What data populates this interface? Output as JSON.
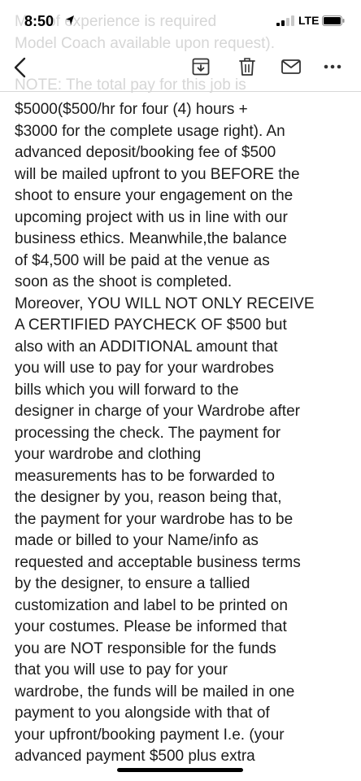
{
  "status_bar": {
    "time": "8:50",
    "network": "LTE"
  },
  "ghost_lines": [
    "M… of experience is required",
    "Model Coach available upon request).",
    "NOTE: The total pay for this job is"
  ],
  "toolbar": {
    "back": "<"
  },
  "message": {
    "lines": [
      "$5000($500/hr for four (4) hours +",
      "$3000 for the complete usage right). An",
      "advanced deposit/booking fee of $500",
      "will be mailed upfront to you BEFORE the",
      "shoot to ensure your engagement on the",
      "upcoming project with us in line with our",
      "business ethics. Meanwhile,the balance",
      "of $4,500 will be paid at the venue as",
      "soon as the shoot is completed.",
      "Moreover, YOU WILL NOT ONLY RECEIVE",
      "A CERTIFIED PAYCHECK OF $500 but",
      "also with an ADDITIONAL amount that",
      "you will use to pay for your wardrobes",
      "bills which you will forward to the",
      "designer in charge of your Wardrobe after",
      "processing the check. The payment for",
      "your wardrobe and clothing",
      "measurements has to be forwarded to",
      "the designer by you, reason being that,",
      "the payment for your wardrobe has to be",
      "made or billed to your Name/info as",
      "requested and acceptable business terms",
      "by the designer, to ensure a tallied",
      "customization and label to be printed on",
      "your costumes. Please be informed that",
      "you are NOT responsible for the funds",
      "that you will use to pay for your",
      "wardrobe, the funds will be mailed in one",
      "payment to you alongside with that of",
      "your upfront/booking payment I.e. (your",
      "advanced payment $500  plus extra"
    ]
  }
}
